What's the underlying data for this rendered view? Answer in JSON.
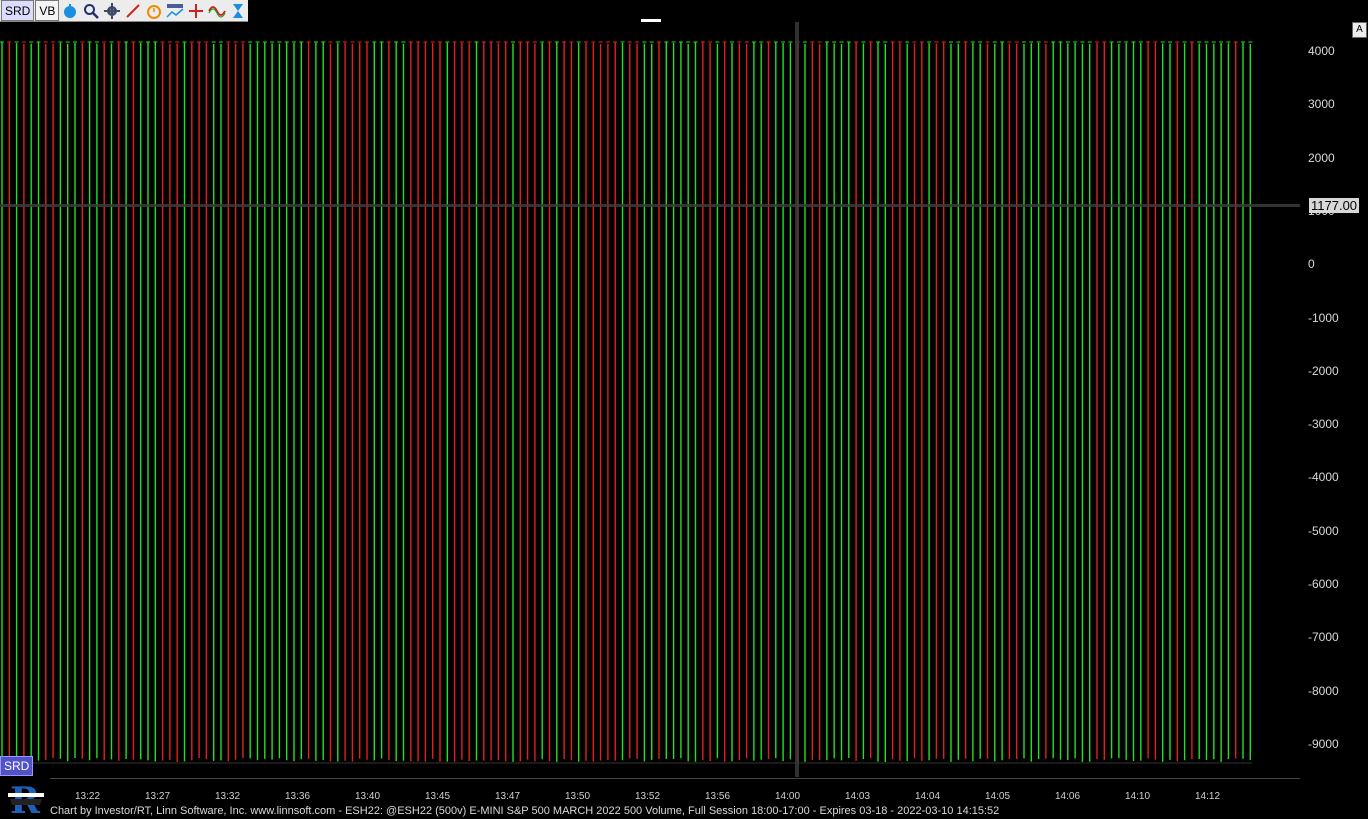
{
  "toolbar": {
    "srd_label": "SRD",
    "vb_label": "VB",
    "icons": [
      "timer-icon",
      "zoom-icon",
      "gear-icon",
      "line-draw-icon",
      "alarm-icon",
      "title-icon",
      "crosshair-icon",
      "wave-icon",
      "hourglass-icon"
    ]
  },
  "colors": {
    "up": "#22e022",
    "down": "#e02020",
    "background": "#000000",
    "footer_text": "#d8d8d8"
  },
  "chart": {
    "price_tag": "1177.00",
    "a_label": "A",
    "srd_label": "SRD",
    "y_ticks": [
      "4000",
      "3000",
      "2000",
      "1000",
      "0",
      "-1000",
      "-2000",
      "-3000",
      "-4000",
      "-5000",
      "-6000",
      "-7000",
      "-8000",
      "-9000"
    ],
    "x_ticks": [
      "13:22",
      "13:27",
      "13:32",
      "13:36",
      "13:40",
      "13:45",
      "13:47",
      "13:50",
      "13:52",
      "13:56",
      "14:00",
      "14:03",
      "14:04",
      "14:05",
      "14:06",
      "14:10",
      "14:12"
    ]
  },
  "chart_data": {
    "type": "bar",
    "y_ticks": [
      4000,
      3000,
      2000,
      1000,
      0,
      -1000,
      -2000,
      -3000,
      -4000,
      -5000,
      -6000,
      -7000,
      -8000,
      -9000
    ],
    "x_tick_labels": [
      "13:22",
      "13:27",
      "13:32",
      "13:36",
      "13:40",
      "13:45",
      "13:47",
      "13:50",
      "13:52",
      "13:56",
      "14:00",
      "14:03",
      "14:04",
      "14:05",
      "14:06",
      "14:10",
      "14:12"
    ],
    "crosshair_value": 1177.0,
    "bars_pattern": "alternating up (green) and down (red) oscillation between about -9300 and 4200"
  },
  "footer": {
    "text": "Chart by Investor/RT, Linn Software, Inc. www.linnsoft.com - ESH22: @ESH22 (500v) E-MINI S&P 500 MARCH 2022 500 Volume, Full Session 18:00-17:00 - Expires 03-18 - 2022-03-10 14:15:52"
  }
}
